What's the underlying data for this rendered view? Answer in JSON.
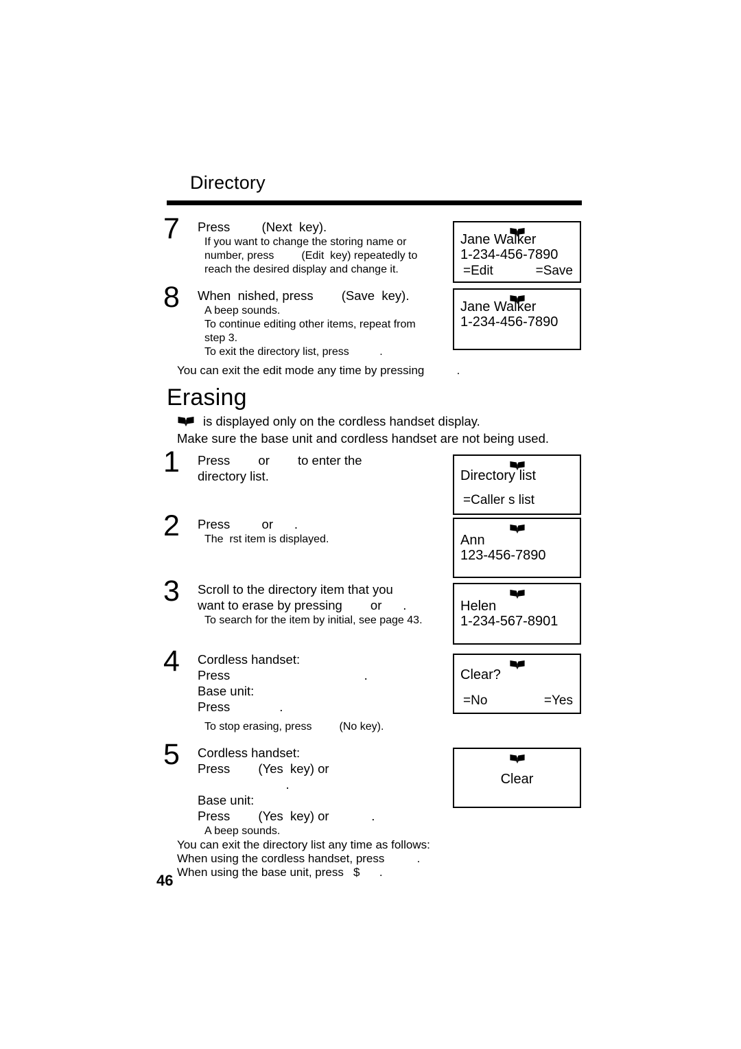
{
  "page": {
    "number": "46",
    "running_head": "Directory"
  },
  "icons": {
    "book": "open-book-icon"
  },
  "sections": [
    {
      "id": "directory",
      "heading": "Directory",
      "steps": [
        {
          "number": "7",
          "main": "Press         (Next  key).",
          "sub": "If you want to change the storing name or\nnumber, press         (Edit  key) repeatedly to\nreach the desired display and change it."
        },
        {
          "number": "8",
          "main": "When  nished, press        (Save  key).",
          "sub": "A beep sounds.\nTo continue editing other items, repeat from\nstep 3.\nTo exit the directory list, press          ."
        }
      ],
      "note": "You can exit the edit mode any time by pressing          ."
    },
    {
      "id": "erasing",
      "heading": "Erasing",
      "intro_icon_line": "is displayed only on the cordless handset display.",
      "intro_line_2": "Make sure the base unit and cordless handset are not being used.",
      "steps": [
        {
          "number": "1",
          "main": "Press        or        to enter the\ndirectory list.",
          "sub": ""
        },
        {
          "number": "2",
          "main": "Press         or      .",
          "sub": "The  rst item is displayed."
        },
        {
          "number": "3",
          "main": "Scroll to the directory item that you\nwant to erase by pressing        or      .",
          "sub": "To search for the item by initial, see page 43."
        },
        {
          "number": "4",
          "main": "Cordless handset:\nPress                                      .\nBase unit:\nPress              .",
          "sub": "To stop erasing, press         (No key)."
        },
        {
          "number": "5",
          "main": "Cordless handset:\nPress        (Yes  key) or\n                         .\nBase unit:\nPress        (Yes  key) or            .",
          "sub": "A beep sounds."
        }
      ],
      "closing": "You can exit the directory list any time as follows:\nWhen using the cordless handset, press          .\nWhen using the base unit, press   $      ."
    }
  ],
  "displays": [
    {
      "id": "display-jane-walker-edit",
      "icon": "open-book-icon",
      "line1": "Jane Walker",
      "line2": "1-234-456-7890",
      "soft_left": "=Edit",
      "soft_right": "=Save"
    },
    {
      "id": "display-jane-walker-saved",
      "icon": "open-book-icon",
      "line1": "Jane Walker",
      "line2": "1-234-456-7890",
      "soft_left": "",
      "soft_right": ""
    },
    {
      "id": "display-directory-list",
      "icon": "open-book-icon",
      "line1": "Directory list",
      "line2": "",
      "soft_left": "=Caller s list",
      "soft_right": ""
    },
    {
      "id": "display-ann",
      "icon": "open-book-icon",
      "line1": "Ann",
      "line2": "123-456-7890",
      "soft_left": "",
      "soft_right": ""
    },
    {
      "id": "display-helen",
      "icon": "open-book-icon",
      "line1": "Helen",
      "line2": "1-234-567-8901",
      "soft_left": "",
      "soft_right": ""
    },
    {
      "id": "display-clear-confirm",
      "icon": "open-book-icon",
      "line1": "Clear?",
      "line2": "",
      "soft_left": "=No",
      "soft_right": "=Yes"
    },
    {
      "id": "display-clear-done",
      "icon": "open-book-icon",
      "line1": "Clear",
      "line2": "",
      "soft_left": "",
      "soft_right": ""
    }
  ],
  "colors": {
    "text": "#000000",
    "background": "#ffffff",
    "rule": "#000000"
  }
}
